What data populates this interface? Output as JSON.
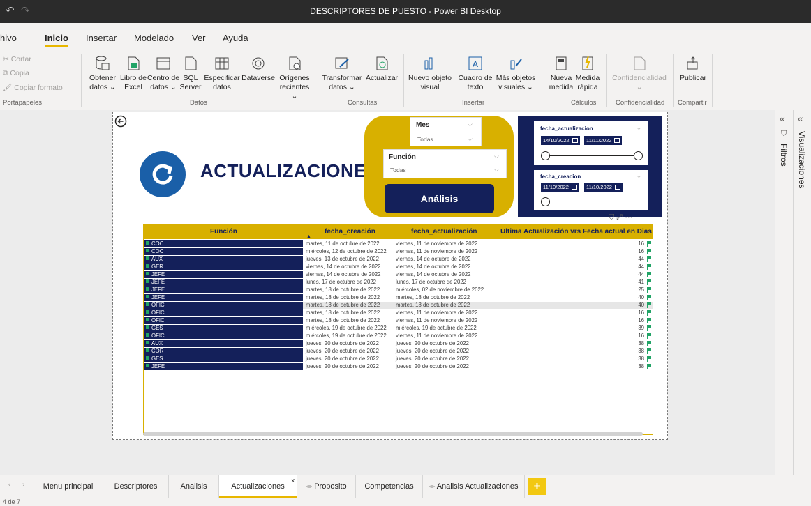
{
  "window": {
    "title": "DESCRIPTORES DE PUESTO - Power BI Desktop"
  },
  "menu": {
    "tabs": [
      "hivo",
      "Inicio",
      "Insertar",
      "Modelado",
      "Ver",
      "Ayuda"
    ],
    "active": "Inicio"
  },
  "ribbon": {
    "clipboard": {
      "cut": "Cortar",
      "copy": "Copia",
      "format": "Copiar formato",
      "label": "Portapapeles"
    },
    "datos": {
      "label": "Datos",
      "buttons": [
        {
          "l1": "Obtener",
          "l2": "datos ⌄"
        },
        {
          "l1": "Libro de",
          "l2": "Excel"
        },
        {
          "l1": "Centro de",
          "l2": "datos ⌄"
        },
        {
          "l1": "SQL",
          "l2": "Server"
        },
        {
          "l1": "Especificar",
          "l2": "datos"
        },
        {
          "l1": "Dataverse",
          "l2": ""
        },
        {
          "l1": "Orígenes",
          "l2": "recientes ⌄"
        }
      ]
    },
    "consultas": {
      "label": "Consultas",
      "buttons": [
        {
          "l1": "Transformar",
          "l2": "datos ⌄"
        },
        {
          "l1": "Actualizar",
          "l2": ""
        }
      ]
    },
    "insertar": {
      "label": "Insertar",
      "buttons": [
        {
          "l1": "Nuevo objeto",
          "l2": "visual"
        },
        {
          "l1": "Cuadro de",
          "l2": "texto"
        },
        {
          "l1": "Más objetos",
          "l2": "visuales ⌄"
        }
      ]
    },
    "calculos": {
      "label": "Cálculos",
      "buttons": [
        {
          "l1": "Nueva",
          "l2": "medida"
        },
        {
          "l1": "Medida",
          "l2": "rápida"
        }
      ]
    },
    "confidencialidad": {
      "label": "Confidencialidad",
      "button": "Confidencialidad",
      "chev": "⌄"
    },
    "compartir": {
      "label": "Compartir",
      "button": "Publicar"
    }
  },
  "report": {
    "title": "ACTUALIZACIONES",
    "slicers": {
      "mes": {
        "title": "Mes",
        "value": "Todas"
      },
      "funcion": {
        "title": "Función",
        "value": "Todas"
      }
    },
    "analisis_button": "Análisis",
    "date_slicers": {
      "actualizacion": {
        "title": "fecha_actualizacion",
        "from": "14/10/2022",
        "to": "11/11/2022"
      },
      "creacion": {
        "title": "fecha_creacion",
        "from": "11/10/2022",
        "to": "11/10/2022"
      }
    },
    "table": {
      "headers": [
        "Función",
        "fecha_creación",
        "fecha_actualización",
        "Ultima Actualización vrs Fecha actual en Dias"
      ],
      "rows": [
        {
          "fn": "COC",
          "cre": "martes, 11 de octubre de 2022",
          "act": "viernes, 11 de noviembre de 2022",
          "dias": "16"
        },
        {
          "fn": "COC",
          "cre": "miércoles, 12 de octubre de 2022",
          "act": "viernes, 11 de noviembre de 2022",
          "dias": "16"
        },
        {
          "fn": "AUX",
          "cre": "jueves, 13 de octubre de 2022",
          "act": "viernes, 14 de octubre de 2022",
          "dias": "44"
        },
        {
          "fn": "GER",
          "cre": "viernes, 14 de octubre de 2022",
          "act": "viernes, 14 de octubre de 2022",
          "dias": "44"
        },
        {
          "fn": "JEFE",
          "cre": "viernes, 14 de octubre de 2022",
          "act": "viernes, 14 de octubre de 2022",
          "dias": "44"
        },
        {
          "fn": "JEFE",
          "cre": "lunes, 17 de octubre de 2022",
          "act": "lunes, 17 de octubre de 2022",
          "dias": "41"
        },
        {
          "fn": "JEFE",
          "cre": "martes, 18 de octubre de 2022",
          "act": "miércoles, 02 de noviembre de 2022",
          "dias": "25"
        },
        {
          "fn": "JEFE",
          "cre": "martes, 18 de octubre de 2022",
          "act": "martes, 18 de octubre de 2022",
          "dias": "40"
        },
        {
          "fn": "OFIC",
          "cre": "martes, 18 de octubre de 2022",
          "act": "martes, 18 de octubre de 2022",
          "dias": "40"
        },
        {
          "fn": "OFIC",
          "cre": "martes, 18 de octubre de 2022",
          "act": "viernes, 11 de noviembre de 2022",
          "dias": "16"
        },
        {
          "fn": "OFIC",
          "cre": "martes, 18 de octubre de 2022",
          "act": "viernes, 11 de noviembre de 2022",
          "dias": "16"
        },
        {
          "fn": "GES",
          "cre": "miércoles, 19 de octubre de 2022",
          "act": "miércoles, 19 de octubre de 2022",
          "dias": "39"
        },
        {
          "fn": "OFIC",
          "cre": "miércoles, 19 de octubre de 2022",
          "act": "viernes, 11 de noviembre de 2022",
          "dias": "16"
        },
        {
          "fn": "AUX",
          "cre": "jueves, 20 de octubre de 2022",
          "act": "jueves, 20 de octubre de 2022",
          "dias": "38"
        },
        {
          "fn": "COR",
          "cre": "jueves, 20 de octubre de 2022",
          "act": "jueves, 20 de octubre de 2022",
          "dias": "38"
        },
        {
          "fn": "GES",
          "cre": "jueves, 20 de octubre de 2022",
          "act": "jueves, 20 de octubre de 2022",
          "dias": "38"
        },
        {
          "fn": "JEFE",
          "cre": "jueves, 20 de octubre de 2022",
          "act": "jueves, 20 de octubre de 2022",
          "dias": "38"
        }
      ],
      "highlighted_row": 8
    }
  },
  "panes": {
    "filtros": "Filtros",
    "visualizaciones": "Visualizaciones"
  },
  "page_tabs": [
    "Menu principal",
    "Descriptores",
    "Analisis",
    "Actualizaciones",
    "Proposito",
    "Competencias",
    "Analisis Actualizaciones"
  ],
  "active_page": "Actualizaciones",
  "status": {
    "page": "4 de 7"
  },
  "colors": {
    "navy": "#14205a",
    "gold": "#d8b000",
    "accent": "#e8b700"
  }
}
